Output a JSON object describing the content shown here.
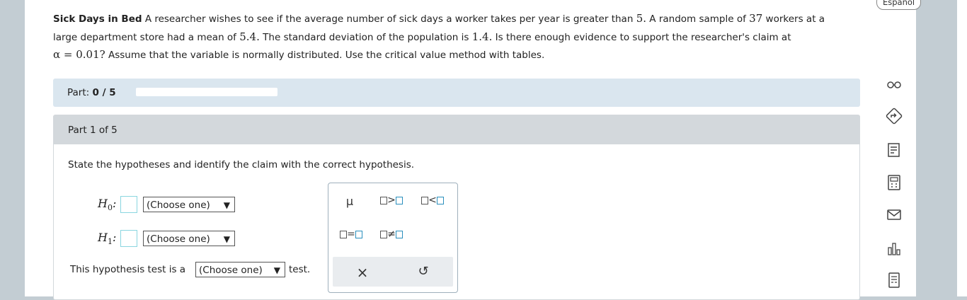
{
  "problem": {
    "title": "Sick Days in Bed",
    "line1a": "A researcher wishes to see if the average number of sick days a worker takes per year is greater than",
    "v5": "5.",
    "line1b": "A random sample of",
    "v37": "37",
    "line1c": "workers at a",
    "line2a": "large department store had a mean of",
    "v54": "5.4.",
    "line2b": "The standard deviation of the population is",
    "v14": "1.4.",
    "line2c": "Is there enough evidence to support the researcher's claim at",
    "alpha": "α = 0.01?",
    "line3": "Assume that the variable is normally distributed. Use the critical value method with tables."
  },
  "part_bar": {
    "label": "Part:",
    "value": "0 / 5",
    "progress": 0
  },
  "part_card": {
    "header": "Part 1 of 5",
    "statement": "State the hypotheses and identify the claim with the correct hypothesis.",
    "h0_label": "H",
    "h0_sub": "0",
    "h1_label": "H",
    "h1_sub": "1",
    "colon": ":",
    "choose": "(Choose one)",
    "arrow": "▼",
    "test_prefix": "This hypothesis test is a",
    "test_suffix": "test."
  },
  "palette": {
    "mu": "μ",
    "gt": ">",
    "lt": "<",
    "eq": "=",
    "neq": "≠",
    "clear": "×",
    "undo": "↺"
  },
  "sidebar": {
    "language": "Español",
    "icons": [
      "glasses-icon",
      "direction-sign-icon",
      "textbook-icon",
      "calculator-icon",
      "mail-icon",
      "bar-chart-icon",
      "data-table-icon"
    ]
  },
  "colors": {
    "accent": "#2a8fbd",
    "part_bar_bg": "#dae6ef",
    "card_head_bg": "#d3d8dc",
    "answer_box_border": "#8ad6e0"
  }
}
